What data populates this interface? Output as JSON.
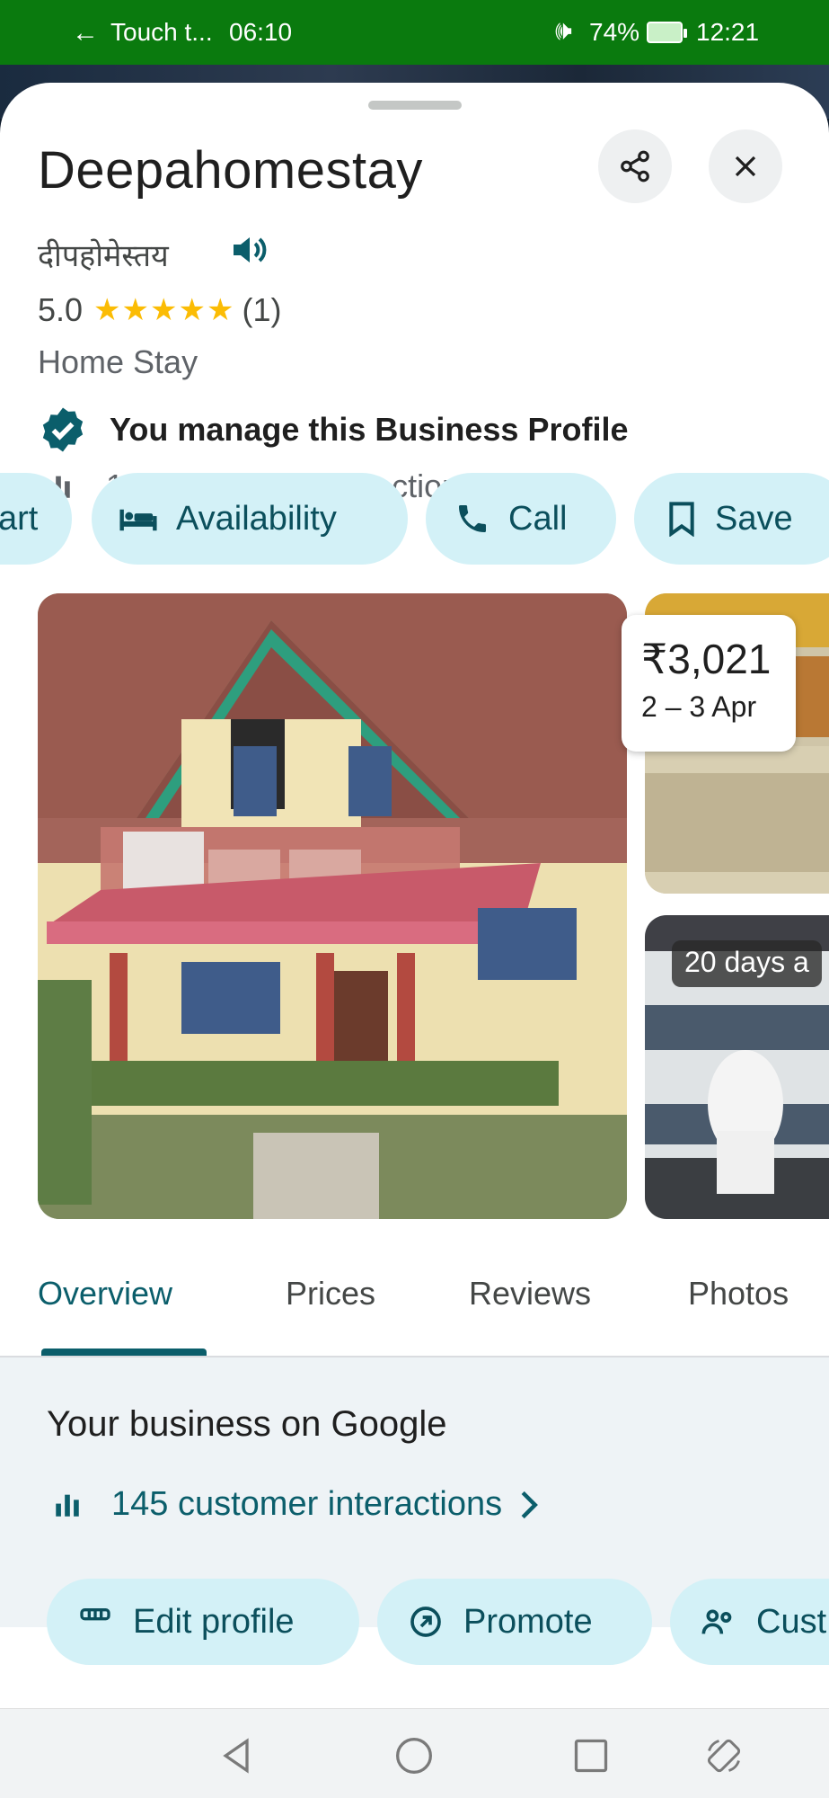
{
  "status_bar": {
    "back_arrow": "←",
    "app_label": "Touch t...",
    "time_left": "06:10",
    "volume_icon": "🕪",
    "battery_percent": "74%",
    "time_right": "12:21"
  },
  "place": {
    "name": "Deepahomestay",
    "native_name": "दीपहोमेस्तय",
    "rating": "5.0",
    "stars": "★★★★★",
    "review_count": "(1)",
    "category": "Home Stay",
    "manage_text": "You manage this Business Profile",
    "interactions": "145 customer interactions"
  },
  "actions": {
    "start_partial": "art",
    "availability": "Availability",
    "call": "Call",
    "save": "Save"
  },
  "photos": {
    "price": "₹3,021",
    "dates": "2 – 3 Apr",
    "age_badge": "20 days a"
  },
  "tabs": {
    "overview": "Overview",
    "prices": "Prices",
    "reviews": "Reviews",
    "photos": "Photos"
  },
  "business": {
    "title": "Your business on Google",
    "interactions_link": "145 customer interactions",
    "edit_profile": "Edit profile",
    "promote": "Promote",
    "customers": "Cust"
  },
  "colors": {
    "status_bar": "#0a7a0e",
    "accent": "#0b5e6b",
    "chip_bg": "#d3f1f7",
    "star": "#fbbc04"
  }
}
